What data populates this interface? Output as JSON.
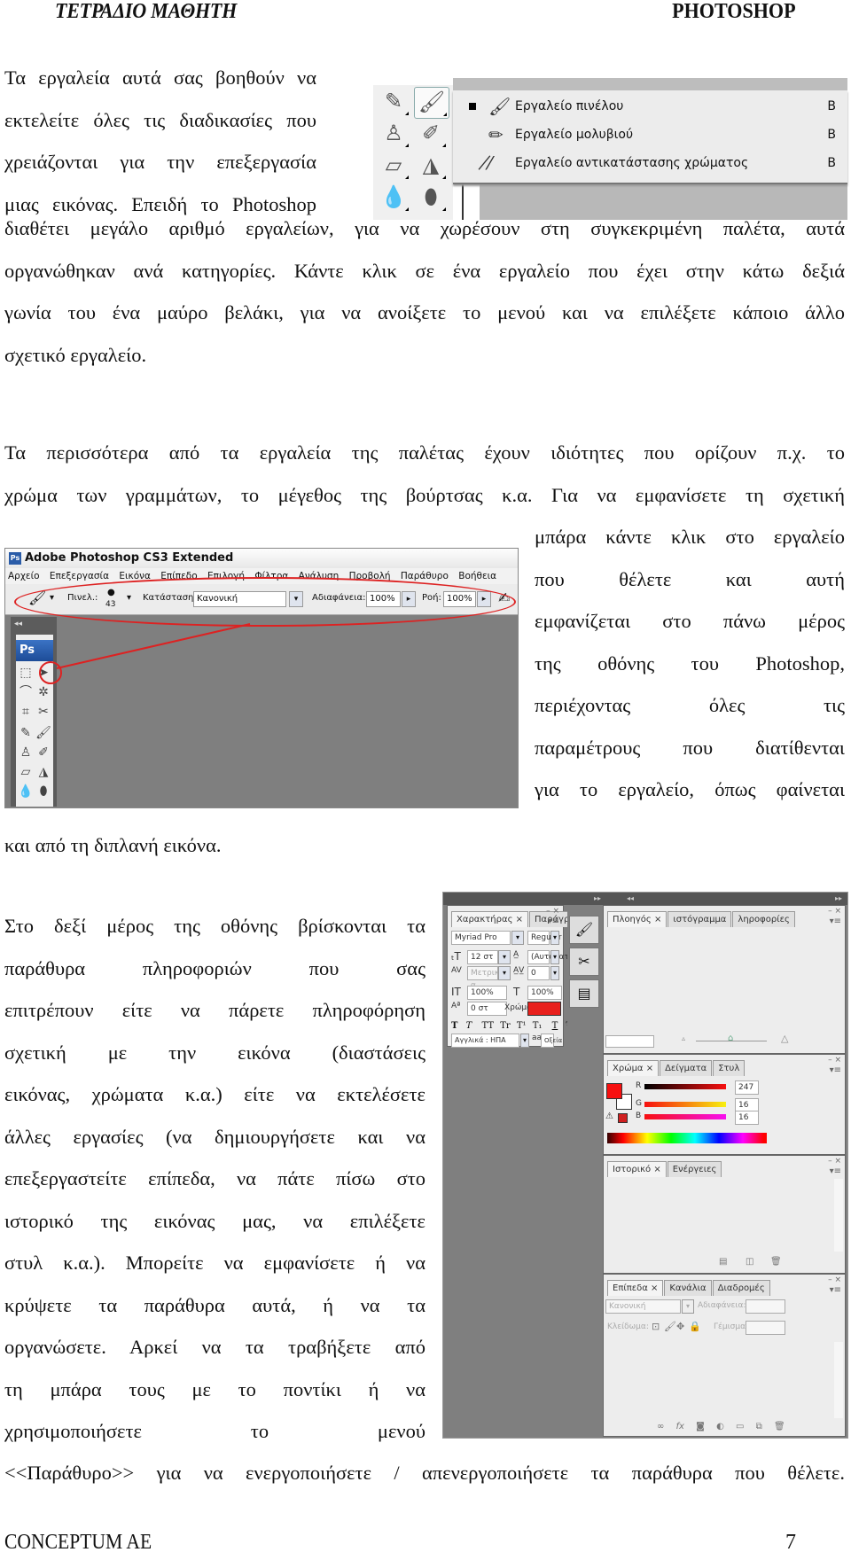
{
  "header": {
    "title_left": "ΤΕΤΡΑΔΙΟ ΜΑΘΗΤΗ",
    "title_right": "PHOTOSHOP"
  },
  "paragraphs": {
    "p1_lines": [
      "Τα εργαλεία αυτά σας βοηθούν να",
      "εκτελείτε όλες τις διαδικασίες που",
      "χρειάζονται για την επεξεργασία",
      "μιας εικόνας. Επειδή το Photoshop",
      "διαθέτει μεγάλο αριθμό εργαλείων, για να χωρέσουν στη συγκεκριμένη παλέτα, αυτά",
      "οργανώθηκαν ανά κατηγορίες. Κάντε κλικ σε ένα εργαλείο που έχει στην κάτω δεξιά",
      "γωνία του  ένα μαύρο βελάκι, για να ανοίξετε το μενού και να επιλέξετε κάποιο άλλο",
      "σχετικό εργαλείο."
    ],
    "p2_lines": [
      "Τα περισσότερα από τα εργαλεία της παλέτας έχουν ιδιότητες που ορίζουν π.χ. το",
      "χρώμα των γραμμάτων, το μέγεθος της βούρτσας κ.α. Για να εμφανίσετε τη σχετική",
      "μπάρα κάντε κλικ στο εργαλείο",
      "που θέλετε και αυτή",
      "εμφανίζεται στο πάνω μέρος",
      "της οθόνης του Photoshop,",
      "περιέχοντας όλες τις",
      "παραμέτρους που διατίθενται",
      "για το εργαλείο, όπως φαίνεται",
      "και από τη διπλανή εικόνα."
    ],
    "p3_lines": [
      "Στο δεξί μέρος της οθόνης βρίσκονται τα",
      "παράθυρα πληροφοριών που σας",
      "επιτρέπουν είτε να πάρετε πληροφόρηση",
      "σχετική με την εικόνα (διαστάσεις",
      "εικόνας, χρώματα κ.α.) είτε να εκτελέσετε",
      "άλλες εργασίες (να δημιουργήσετε και να",
      "επεξεργαστείτε επίπεδα, να πάτε πίσω στο",
      "ιστορικό της εικόνας μας, να επιλέξετε",
      "στυλ κ.α.). Μπορείτε να εμφανίσετε ή να",
      "κρύψετε τα παράθυρα αυτά, ή να τα",
      "οργανώσετε. Αρκεί να τα τραβήξετε από",
      "τη μπάρα τους με το ποντίκι ή να",
      "χρησιμοποιήσετε το μενού",
      "<<Παράθυρο>> για να ενεργοποιήσετε / απενεργοποιήσετε τα παράθυρα που θέλετε."
    ]
  },
  "flyout": {
    "items": [
      {
        "label": "Εργαλείο πινέλου",
        "shortcut": "B",
        "icon": "brush-icon",
        "selected": true
      },
      {
        "label": "Εργαλείο μολυβιού",
        "shortcut": "B",
        "icon": "pencil-icon",
        "selected": false
      },
      {
        "label": "Εργαλείο αντικατάστασης χρώματος",
        "shortcut": "B",
        "icon": "color-replacement-icon",
        "selected": false
      }
    ]
  },
  "ps_window": {
    "title": "Adobe Photoshop CS3 Extended",
    "logo": "Ps",
    "menu": [
      "Αρχείο",
      "Επεξεργασία",
      "Εικόνα",
      "Επίπεδο",
      "Επιλογή",
      "Φίλτρα",
      "Ανάλυση",
      "Προβολή",
      "Παράθυρο",
      "Βοήθεια"
    ],
    "options": {
      "brush_label": "Πινελ.:",
      "brush_size": "43",
      "mode_label": "Κατάσταση:",
      "mode_value": "Κανονική",
      "opacity_label": "Αδιαφάνεια:",
      "opacity_value": "100%",
      "flow_label": "Ροή:",
      "flow_value": "100%"
    },
    "toolbox_collapse": "◂◂",
    "toolbox_logo": "Ps"
  },
  "panels": {
    "character": {
      "tabs": [
        "Χαρακτήρας ×",
        "Παράγραφος"
      ],
      "font_family": "Myriad Pro",
      "font_style": "Regular",
      "font_size": "12 στ",
      "leading": "(Αυτόματ",
      "kerning": "Μετρικό α",
      "tracking": "0",
      "vertical_scale": "100%",
      "horizontal_scale": "100%",
      "baseline_shift": "0 στ",
      "color_label": "Χρώμα:",
      "color": "#e8201c",
      "style_buttons": [
        "T",
        "T",
        "TT",
        "Tr",
        "T¹",
        "T₁",
        "T",
        "Ŧ"
      ],
      "language": "Αγγλικά : ΗΠΑ",
      "antialias_icon": "aa",
      "antialias": "Οξεία"
    },
    "navigator": {
      "tabs": [
        "Πλοηγός ×",
        "ιστόγραμμα",
        "ληροφορίες"
      ]
    },
    "color": {
      "tabs": [
        "Χρώμα ×",
        "Δείγματα",
        "Στυλ"
      ],
      "r_label": "R",
      "g_label": "G",
      "b_label": "B",
      "r": "247",
      "g": "16",
      "b": "16",
      "foreground": "#f71010",
      "background": "#ffffff"
    },
    "history": {
      "tabs": [
        "Ιστορικό ×",
        "Ενέργειες"
      ]
    },
    "layers": {
      "tabs": [
        "Επίπεδα ×",
        "Κανάλια",
        "Διαδρομές"
      ],
      "blend_mode": "Κανονική",
      "opacity_label": "Αδιαφάνεια:",
      "lock_label": "Κλείδωμα:",
      "fill_label": "Γέμισμα:",
      "footer_icons": [
        "∞",
        "fx",
        "◙",
        "◐",
        "▭",
        "⧉",
        "🗑"
      ]
    }
  },
  "footer": {
    "company": "CONCEPTUM AE",
    "page_number": "7"
  }
}
